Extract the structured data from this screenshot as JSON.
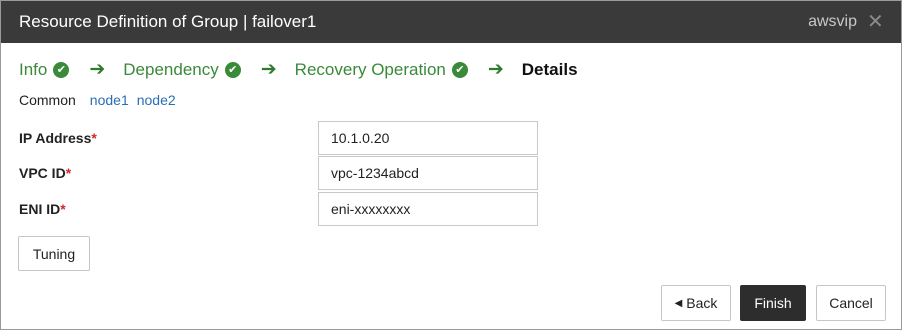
{
  "window": {
    "title": "Resource Definition of Group | failover1",
    "resource_name": "awsvip",
    "close_glyph": "✕"
  },
  "wizard": {
    "steps": [
      {
        "label": "Info",
        "done": true
      },
      {
        "label": "Dependency",
        "done": true
      },
      {
        "label": "Recovery Operation",
        "done": true
      },
      {
        "label": "Details",
        "done": false
      }
    ],
    "arrow_glyph": "➔",
    "check_glyph": "✔"
  },
  "tabs": [
    {
      "label": "Common",
      "active": true
    },
    {
      "label": "node1",
      "active": false
    },
    {
      "label": "node2",
      "active": false
    }
  ],
  "fields": [
    {
      "label": "IP Address",
      "required_mark": "*",
      "value": "10.1.0.20"
    },
    {
      "label": "VPC ID",
      "required_mark": "*",
      "value": "vpc-1234abcd"
    },
    {
      "label": "ENI ID",
      "required_mark": "*",
      "value": "eni-xxxxxxxx"
    }
  ],
  "buttons": {
    "tuning": "Tuning",
    "back": "Back",
    "back_glyph": "◀",
    "finish": "Finish",
    "cancel": "Cancel"
  },
  "colors": {
    "titlebar_bg": "#3a3a3a",
    "step_done": "#3a8a3a",
    "link": "#2a6eb5",
    "required": "#cc2b2b",
    "primary_button": "#2d2d2d"
  }
}
